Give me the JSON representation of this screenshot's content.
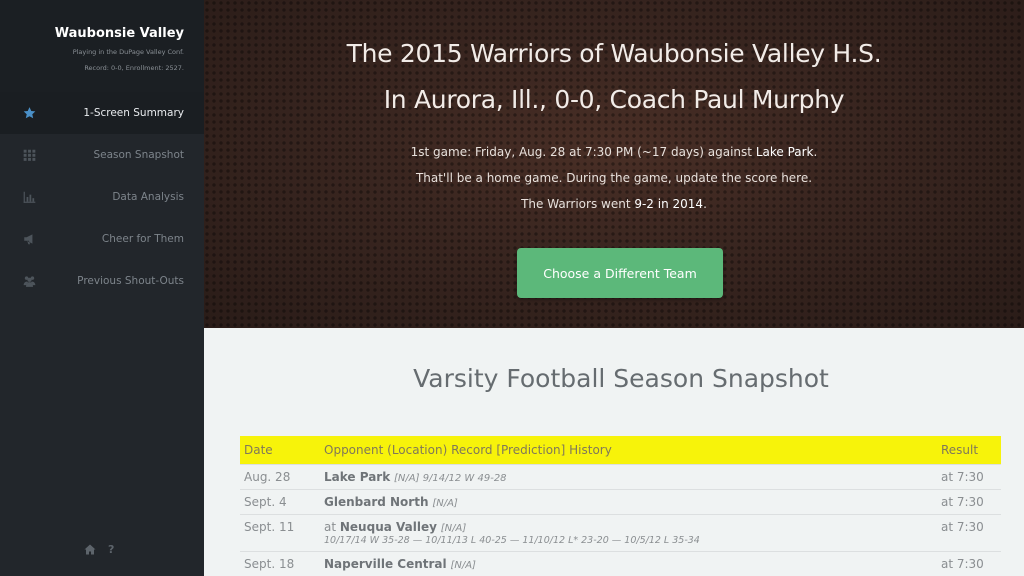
{
  "sidebar": {
    "brand_title": "Waubonsie Valley",
    "brand_sub1": "Playing in the DuPage Valley Conf.",
    "brand_sub2": "Record: 0-0, Enrollment: 2527.",
    "items": [
      {
        "label": "1-Screen Summary",
        "icon": "star-icon",
        "active": true
      },
      {
        "label": "Season Snapshot",
        "icon": "grid-icon",
        "active": false
      },
      {
        "label": "Data Analysis",
        "icon": "bar-chart-icon",
        "active": false
      },
      {
        "label": "Cheer for Them",
        "icon": "megaphone-icon",
        "active": false
      },
      {
        "label": "Previous Shout-Outs",
        "icon": "group-icon",
        "active": false
      }
    ],
    "footer": {
      "home_icon": "home-icon",
      "help_text": "?"
    }
  },
  "hero": {
    "title_line1": "The 2015 Warriors of Waubonsie Valley H.S.",
    "title_line2": "In Aurora, Ill., 0-0, Coach Paul Murphy",
    "line1_pre": "1st game: Friday, Aug. 28 at 7:30 PM (~17 days) against ",
    "line1_opponent": "Lake Park",
    "line1_post": ".",
    "line2": "That'll be a home game. During the game, update the score here.",
    "line3_pre": "The Warriors went ",
    "line3_record": "9-2 in 2014",
    "line3_post": ".",
    "button_label": "Choose a Different Team"
  },
  "snapshot": {
    "title": "Varsity Football Season Snapshot",
    "headers": {
      "date": "Date",
      "opponent": "Opponent (Location) Record [Prediction] History",
      "result": "Result"
    },
    "rows": [
      {
        "date": "Aug. 28",
        "prefix": "",
        "opponent": "Lake Park",
        "info": "[N/A] 9/14/12 W 49-28",
        "history": "",
        "result": "at 7:30"
      },
      {
        "date": "Sept. 4",
        "prefix": "",
        "opponent": "Glenbard North",
        "info": "[N/A]",
        "history": "",
        "result": "at 7:30"
      },
      {
        "date": "Sept. 11",
        "prefix": "at ",
        "opponent": "Neuqua Valley",
        "info": "[N/A]",
        "history": "10/17/14 W 35-28 — 10/11/13 L 40-25 — 11/10/12 L* 23-20 — 10/5/12 L 35-34",
        "result": "at 7:30"
      },
      {
        "date": "Sept. 18",
        "prefix": "",
        "opponent": "Naperville Central",
        "info": "[N/A]",
        "history": "",
        "result": "at 7:30"
      }
    ]
  },
  "colors": {
    "button": "#5cb87a",
    "header_row": "#f7f30a",
    "accent_icon": "#4a90c8"
  }
}
